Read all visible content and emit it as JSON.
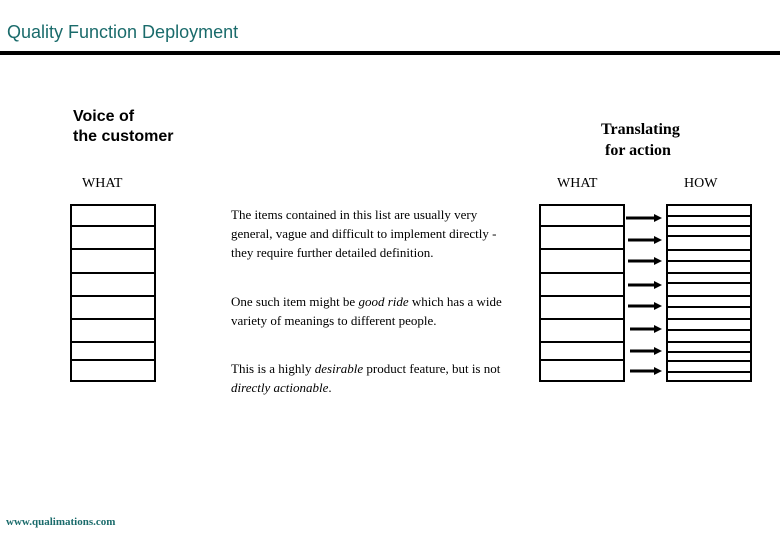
{
  "header": {
    "title": "Quality Function Deployment"
  },
  "left_section": {
    "heading_line1": "Voice of",
    "heading_line2": "the customer",
    "column_label": "WHAT",
    "rows": 8
  },
  "right_section": {
    "heading_line1": "Translating",
    "heading_line2": "for action",
    "what_label": "WHAT",
    "how_label": "HOW",
    "what_rows": 8,
    "how_rows": 16,
    "arrow_count": 8
  },
  "description": {
    "para1": "The items contained in this list are usually very general, vague and difficult to implement directly - they require further detailed definition.",
    "para2_before": "One such item might be ",
    "para2_em": "good ride",
    "para2_after": " which has a wide variety of meanings to different people.",
    "para3_before": "This is a highly ",
    "para3_em1": "desirable",
    "para3_mid": " product feature, but is not ",
    "para3_em2": "directly actionable",
    "para3_after": "."
  },
  "footer": {
    "url": "www.qualimations.com"
  },
  "colors": {
    "accent": "#1a6b6b",
    "line": "#000000"
  }
}
